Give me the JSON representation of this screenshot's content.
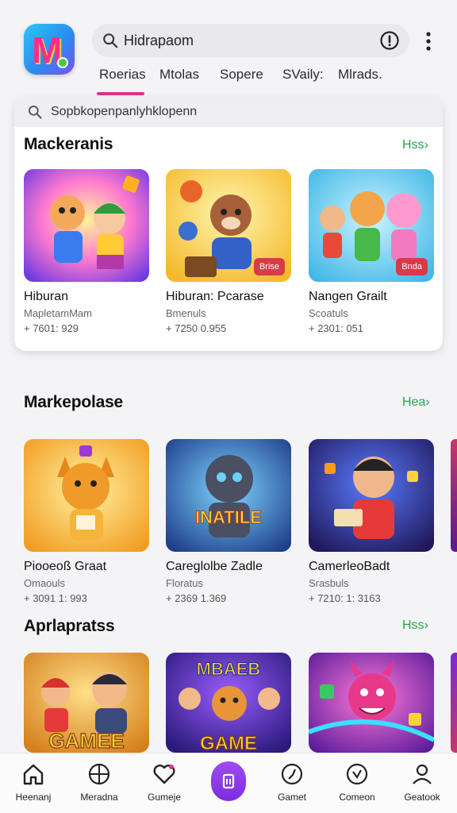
{
  "header": {
    "search_text": "Hidrapaom",
    "colors": {
      "accent": "#e0338e",
      "link": "#1fa64a",
      "nav_center": "#8a3cea"
    }
  },
  "tabs": [
    "Roerias",
    "Mtolas",
    "Sopere",
    "SVaily:",
    "Mlrads."
  ],
  "inner_search_text": "Sopbkopenpanlyhklopenn",
  "sections": [
    {
      "title": "Mackeranis",
      "more": "Hss",
      "games": [
        {
          "title": "Hiburan",
          "sub": "MapletamMam",
          "meta": "+ 7601: 929",
          "badge": ""
        },
        {
          "title": "Hiburan: Pcarase",
          "sub": "Bmenuls",
          "meta": "+ 7250 0.955",
          "badge": "Brise"
        },
        {
          "title": "Nangen Grailt",
          "sub": "Scoatuls",
          "meta": "+ 2301: 051",
          "badge": "Bnda"
        }
      ]
    },
    {
      "title": "Markepolase",
      "more": "Hea",
      "games": [
        {
          "title": "Piooeoß Graat",
          "sub": "Omaouls",
          "meta": "+ 3091 1: 993",
          "badge": ""
        },
        {
          "title": "Careglolbe Zadle",
          "sub": "Floratus",
          "meta": "+ 2369 1.369",
          "badge": "",
          "art_text": "INATILE"
        },
        {
          "title": "CamerleoBadt",
          "sub": "Srasbuls",
          "meta": "+ 7210: 1: 3163",
          "badge": ""
        }
      ]
    },
    {
      "title": "Aprlapratss",
      "more": "Hss",
      "games": [
        {
          "art_text": "GAMEE"
        },
        {
          "art_text": "GAME",
          "art_top": "MBAEB"
        },
        {
          "art_text": ""
        }
      ]
    }
  ],
  "bottom_nav": [
    {
      "label": "Heenanj",
      "icon": "home-icon"
    },
    {
      "label": "Meradna",
      "icon": "grid-globe-icon"
    },
    {
      "label": "Gumeje",
      "icon": "heart-icon"
    },
    {
      "label": "",
      "icon": "center-action-icon"
    },
    {
      "label": "Gamet",
      "icon": "compass-icon"
    },
    {
      "label": "Comeon",
      "icon": "explore-icon"
    },
    {
      "label": "Geatook",
      "icon": "profile-icon"
    }
  ]
}
